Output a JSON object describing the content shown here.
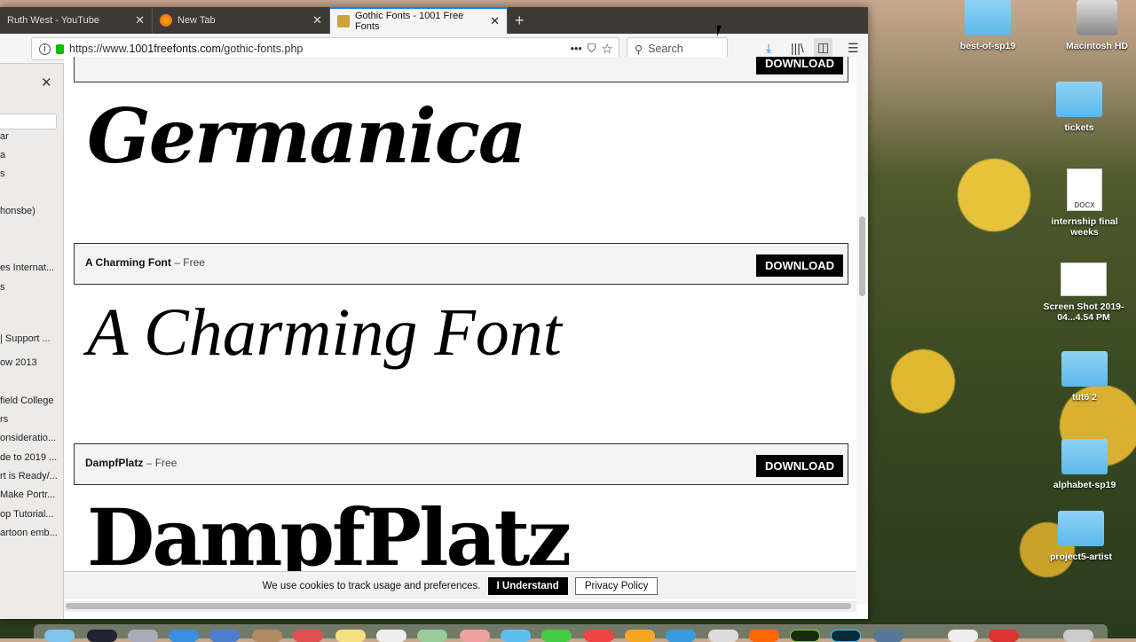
{
  "browser": {
    "tabs": [
      {
        "label": "Ruth West - YouTube"
      },
      {
        "label": "New Tab"
      },
      {
        "label": "Gothic Fonts - 1001 Free Fonts"
      }
    ],
    "url_prefix": "https://www.",
    "url_domain": "1001freefonts.com",
    "url_path": "/gothic-fonts.php",
    "search_placeholder": "Search"
  },
  "sidebar": {
    "items": [
      "ar",
      "a",
      "s",
      "honsbe)",
      "es Internat...",
      "s",
      "| Support ...",
      "ow 2013",
      "field College",
      "rs",
      "onsideratio...",
      "de to 2019 ...",
      "rt is Ready/...",
      "Make Portr...",
      "op Tutorial...",
      "artoon emb..."
    ]
  },
  "fonts": [
    {
      "name": "",
      "license": "",
      "download": "DOWNLOAD",
      "preview": "Germanica"
    },
    {
      "name": "A Charming Font",
      "license": "– Free",
      "download": "DOWNLOAD",
      "preview": "A Charming Font"
    },
    {
      "name": "DampfPlatz",
      "license": "– Free",
      "download": "DOWNLOAD",
      "preview": "DampfPlatz"
    }
  ],
  "cookie": {
    "text": "We use cookies to track usage and preferences.",
    "accept": "I Understand",
    "privacy": "Privacy Policy"
  },
  "desktop": {
    "icons": [
      "best-of-sp19",
      "Macintosh HD",
      "tickets",
      "internship final weeks",
      "Screen Shot 2019-04...4.54 PM",
      "tut6 2",
      "alphabet-sp19",
      "project5-artist"
    ],
    "doc_label": "DOCX"
  },
  "colors": {
    "accent": "#0a84ff",
    "download_bg": "#000000"
  }
}
